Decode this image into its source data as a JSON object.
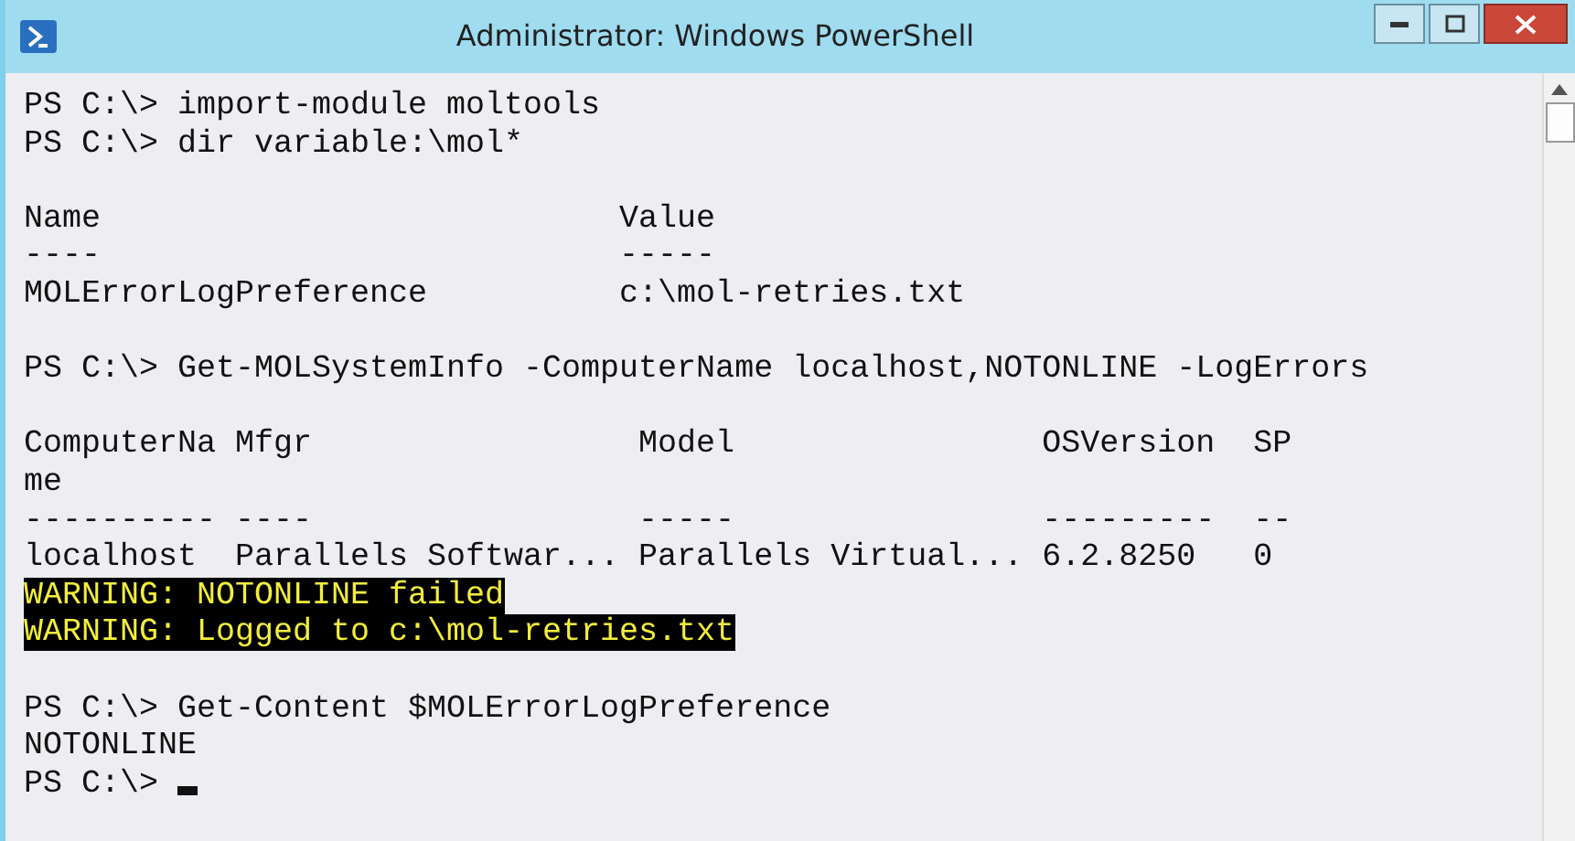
{
  "window": {
    "title": "Administrator: Windows PowerShell"
  },
  "console": {
    "lines": [
      {
        "kind": "output",
        "text": "PS C:\\> import-module moltools"
      },
      {
        "kind": "output",
        "text": "PS C:\\> dir variable:\\mol*"
      },
      {
        "kind": "blank"
      },
      {
        "kind": "output",
        "text": "Name                           Value"
      },
      {
        "kind": "output",
        "text": "----                           -----"
      },
      {
        "kind": "output",
        "text": "MOLErrorLogPreference          c:\\mol-retries.txt"
      },
      {
        "kind": "blank"
      },
      {
        "kind": "output",
        "text": "PS C:\\> Get-MOLSystemInfo -ComputerName localhost,NOTONLINE -LogErrors"
      },
      {
        "kind": "blank"
      },
      {
        "kind": "output",
        "text": "ComputerNa Mfgr                 Model                OSVersion  SP"
      },
      {
        "kind": "output",
        "text": "me"
      },
      {
        "kind": "output",
        "text": "---------- ----                 -----                ---------  --"
      },
      {
        "kind": "output",
        "text": "localhost  Parallels Softwar... Parallels Virtual... 6.2.8250   0"
      },
      {
        "kind": "warning",
        "text": "WARNING: NOTONLINE failed"
      },
      {
        "kind": "warning",
        "text": "WARNING: Logged to c:\\mol-retries.txt"
      },
      {
        "kind": "blank"
      },
      {
        "kind": "output",
        "text": "PS C:\\> Get-Content $MOLErrorLogPreference"
      },
      {
        "kind": "output",
        "text": "NOTONLINE"
      }
    ],
    "prompt": {
      "text": "PS C:\\>",
      "cursor": true
    }
  }
}
